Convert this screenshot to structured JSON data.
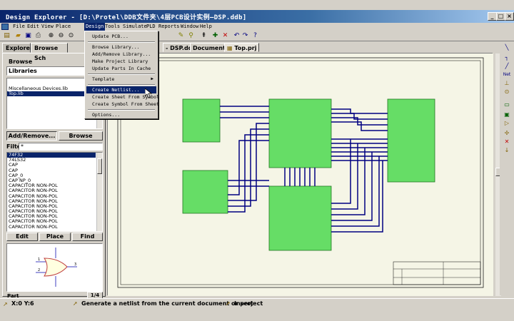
{
  "window": {
    "title": "Design Explorer - [D:\\Protel\\DDB文件夹\\4层PCB设计实例—DSP.ddb]",
    "minimize": "_",
    "maximize": "□",
    "close": "×"
  },
  "menubar": {
    "items": [
      "File",
      "Edit",
      "View",
      "Place",
      "Design",
      "Tools",
      "Simulate",
      "PLD",
      "Reports",
      "Window",
      "Help"
    ],
    "active": "Design"
  },
  "left_panel": {
    "tabs": [
      "Explorer",
      "Browse Sch"
    ],
    "browse_label": "Browse",
    "libraries_value": "Libraries",
    "libraries_list": [
      "Miscellaneous Devices.lib",
      "Top.lib"
    ],
    "selected_library": "Top.lib",
    "add_remove_button": "Add/Remove...",
    "browse_button": "Browse",
    "filter_label": "Filter",
    "filter_value": "*",
    "components": [
      "74F32",
      "74LS32",
      "CAP",
      "CAP",
      "CAP_0",
      "CAP NP_0",
      "CAPACITOR NON-POL",
      "CAPACITOR NON-POL",
      "CAPACITOR NON-POL",
      "CAPACITOR NON-POL",
      "CAPACITOR NON-POL",
      "CAPACITOR NON-POL",
      "CAPACITOR NON-POL",
      "CAPACITOR NON-POL",
      "CAPACITOR NON-POL"
    ],
    "selected_component": "74F32",
    "edit_button": "Edit",
    "place_button": "Place",
    "find_button": "Find",
    "part_label": "Part",
    "part_page": "1/4"
  },
  "doc_tabs": [
    "DSP.ddb",
    "Documents",
    "Top.prj"
  ],
  "design_menu": {
    "items": [
      {
        "label": "Update PCB...",
        "highlighted": false
      },
      {
        "separator": true
      },
      {
        "label": "Browse Library...",
        "highlighted": false
      },
      {
        "label": "Add/Remove Library...",
        "highlighted": false
      },
      {
        "label": "Make Project Library",
        "highlighted": false
      },
      {
        "label": "Update Parts In Cache",
        "highlighted": false
      },
      {
        "separator": true
      },
      {
        "label": "Template",
        "submenu": true,
        "highlighted": false
      },
      {
        "separator": true
      },
      {
        "label": "Create Netlist...",
        "highlighted": true
      },
      {
        "label": "Create Sheet From Symbol",
        "highlighted": false
      },
      {
        "label": "Create Symbol From Sheet",
        "highlighted": false
      },
      {
        "separator": true
      },
      {
        "label": "Options...",
        "highlighted": false
      }
    ]
  },
  "status_bar": {
    "coords": "X:0 Y:6",
    "hint": "Generate a netlist from the current document or project",
    "mode": "Insert"
  },
  "colors": {
    "title_active": "#0a246a",
    "block_fill": "#66dd66",
    "block_border": "#227722",
    "wire": "#000080",
    "sheet_bg": "#f5f5e6"
  },
  "icons": {
    "system_menu": "protel-icon",
    "toolbar": [
      "open-folder-icon",
      "save-icon",
      "print-icon",
      "zoom-in-icon",
      "zoom-out-icon",
      "zoom-fit-icon",
      "undo-icon",
      "redo-icon",
      "help-icon"
    ]
  }
}
